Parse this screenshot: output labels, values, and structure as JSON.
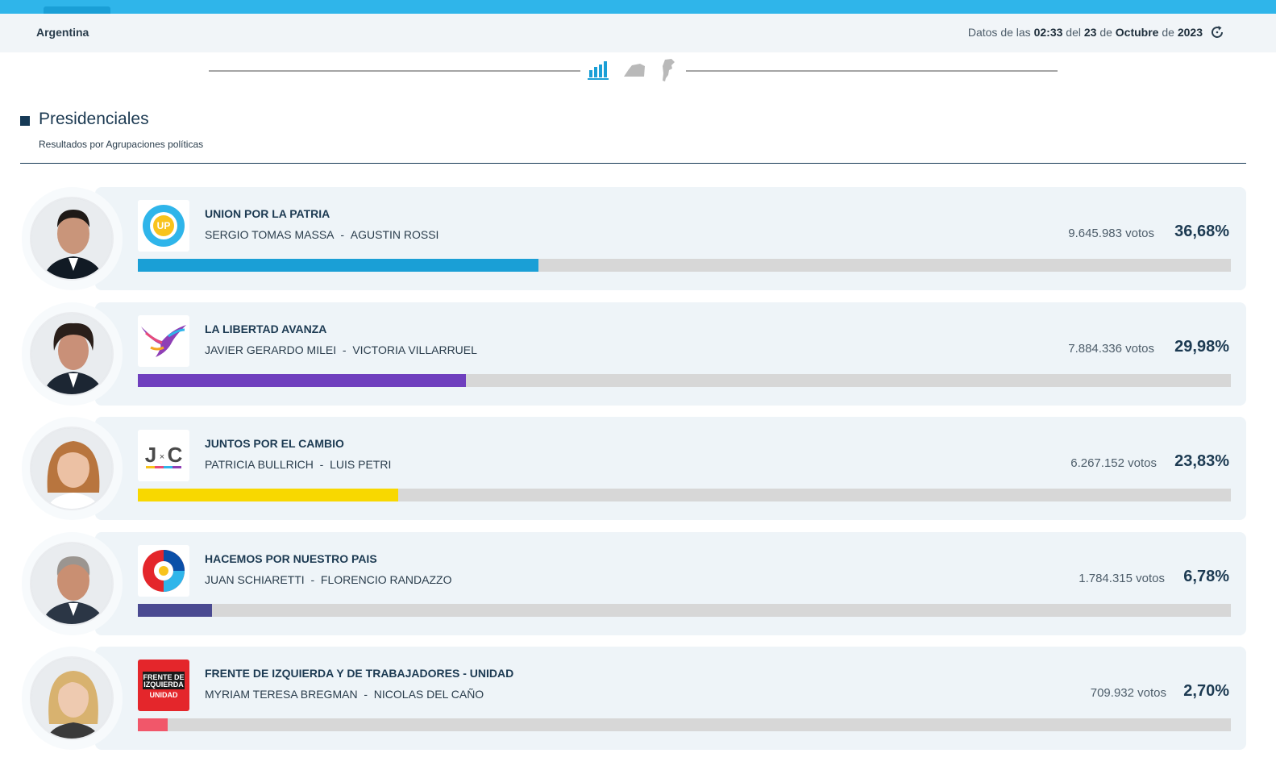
{
  "header": {
    "region": "Argentina",
    "stamp_prefix": "Datos de las",
    "time": "02:33",
    "stamp_del": "del",
    "day": "23",
    "stamp_de1": "de",
    "month": "Octubre",
    "stamp_de2": "de",
    "year": "2023"
  },
  "nav": {
    "icons": [
      "bar-chart-icon",
      "province-map-icon",
      "country-map-icon"
    ],
    "active_color": "#1a9fd6",
    "inactive_color": "#b9b9b9"
  },
  "section": {
    "title": "Presidenciales",
    "subtitle": "Resultados por Agrupaciones políticas"
  },
  "results": [
    {
      "party": "UNION POR LA PATRIA",
      "candidate1": "SERGIO TOMAS MASSA",
      "separator": "-",
      "candidate2": "AGUSTIN ROSSI",
      "votes": "9.645.983 votos",
      "percent_label": "36,68%",
      "percent": 36.68,
      "color": "#1a9fd6"
    },
    {
      "party": "LA LIBERTAD AVANZA",
      "candidate1": "JAVIER GERARDO MILEI",
      "separator": "-",
      "candidate2": "VICTORIA VILLARRUEL",
      "votes": "7.884.336 votos",
      "percent_label": "29,98%",
      "percent": 29.98,
      "color": "#6f3fbe"
    },
    {
      "party": "JUNTOS POR EL CAMBIO",
      "candidate1": "PATRICIA BULLRICH",
      "separator": "-",
      "candidate2": "LUIS PETRI",
      "votes": "6.267.152 votos",
      "percent_label": "23,83%",
      "percent": 23.83,
      "color": "#f8d800"
    },
    {
      "party": "HACEMOS POR NUESTRO PAIS",
      "candidate1": "JUAN SCHIARETTI",
      "separator": "-",
      "candidate2": "FLORENCIO RANDAZZO",
      "votes": "1.784.315 votos",
      "percent_label": "6,78%",
      "percent": 6.78,
      "color": "#4a4a91"
    },
    {
      "party": "FRENTE DE IZQUIERDA Y DE TRABAJADORES - UNIDAD",
      "candidate1": "MYRIAM TERESA BREGMAN",
      "separator": "-",
      "candidate2": "NICOLAS DEL CAÑO",
      "votes": "709.932 votos",
      "percent_label": "2,70%",
      "percent": 2.7,
      "color": "#f1576a"
    }
  ],
  "logos": {
    "up": "UP",
    "jxc_j": "J",
    "jxc_x": "×",
    "jxc_c": "C",
    "fit_line1": "FRENTE DE",
    "fit_line2": "IZQUIERDA",
    "fit_line3": "UNIDAD"
  }
}
